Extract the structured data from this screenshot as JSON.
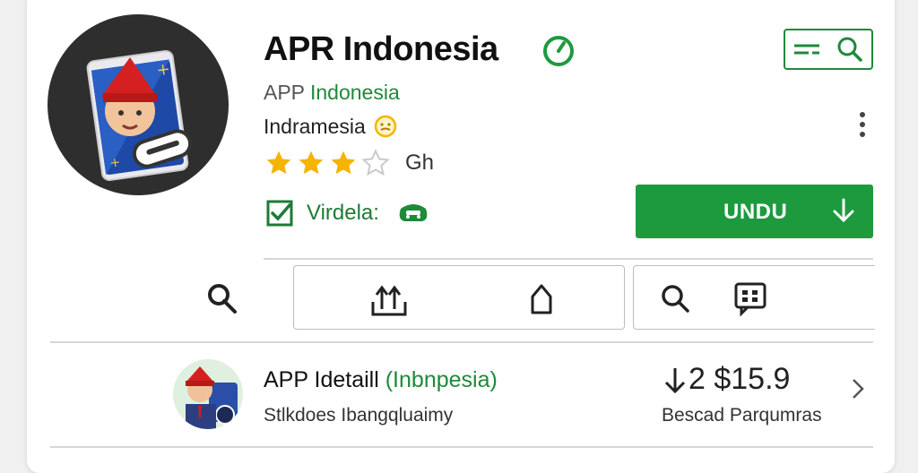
{
  "app": {
    "title": "APR Indonesia",
    "developer_prefix": "APP ",
    "developer_brand": "Indonesia",
    "region": "Indramesia",
    "rating_stars": 3,
    "rating_max": 5,
    "rating_text": "Gh",
    "badge_label": "Virdela:"
  },
  "actions": {
    "install_label": "UNDU"
  },
  "icons": {
    "verified": "verified-check-icon",
    "filter": "filter-icon",
    "search": "search-icon",
    "more": "more-vert-icon",
    "download": "download-icon",
    "share": "share-icon",
    "wishlist": "bookmark-icon",
    "chat": "chat-icon"
  },
  "list_item": {
    "title_main": "APP Idetaill ",
    "title_paren": "(Inbnpesia)",
    "subtitle": "Stlkdoes Ibangqluaimy",
    "price": "2 $15.9",
    "price_sub": "Bescad Parqumras"
  },
  "colors": {
    "accent_green": "#1e9a3e",
    "star_gold": "#f4b400",
    "icon_bg": "#2e2e2e"
  }
}
